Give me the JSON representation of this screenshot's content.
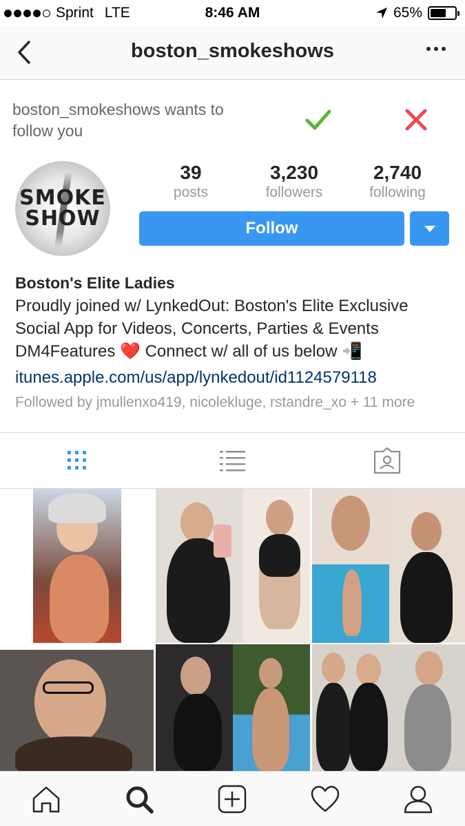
{
  "status_bar": {
    "carrier": "Sprint",
    "network": "LTE",
    "time": "8:46 AM",
    "battery": "65%",
    "battery_level": 0.65,
    "signal_bars": 4
  },
  "nav": {
    "title": "boston_smokeshows",
    "back_icon": "chevron-left-icon",
    "more_icon": "more-horizontal-icon"
  },
  "follow_request": {
    "text": "boston_smokeshows wants to follow you",
    "accept_icon": "checkmark-icon",
    "reject_icon": "close-icon",
    "accept_color": "#5fb33a",
    "reject_color": "#ed4956"
  },
  "profile": {
    "avatar_text_1": "SMOKE",
    "avatar_text_2": "SHOW",
    "stats": [
      {
        "value": "39",
        "label": "posts"
      },
      {
        "value": "3,230",
        "label": "followers"
      },
      {
        "value": "2,740",
        "label": "following"
      }
    ],
    "follow_label": "Follow",
    "accent_color": "#3897f0"
  },
  "bio": {
    "name": "Boston's Elite Ladies",
    "line1": "Proudly joined w/ LynkedOut: Boston's Elite Exclusive",
    "line2": "Social App for Videos, Concerts, Parties & Events",
    "line3": "DM4Features ❤️ Connect w/ all of us below 📲",
    "link": "itunes.apple.com/us/app/lynkedout/id1124579118",
    "followed_by": "Followed by jmullenxo419, nicolekluge, rstandre_xo + 11 more"
  },
  "view_tabs": [
    {
      "icon": "grid-icon",
      "active": true
    },
    {
      "icon": "list-icon",
      "active": false
    },
    {
      "icon": "tagged-photos-icon",
      "active": false
    }
  ],
  "bottom_nav": [
    {
      "icon": "home-icon"
    },
    {
      "icon": "search-icon",
      "active": true
    },
    {
      "icon": "add-post-icon"
    },
    {
      "icon": "heart-icon"
    },
    {
      "icon": "profile-icon"
    }
  ]
}
